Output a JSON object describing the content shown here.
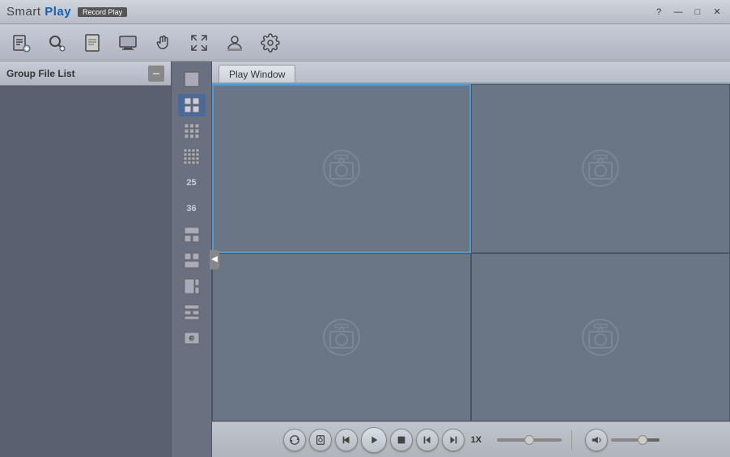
{
  "app": {
    "title_smart": "Smart",
    "title_play": "Play",
    "subtitle": "Record Play"
  },
  "titlebar": {
    "help": "?",
    "minimize": "—",
    "restore": "□",
    "close": "✕"
  },
  "toolbar": {
    "icons": [
      {
        "name": "add-file-icon",
        "label": "Add File"
      },
      {
        "name": "search-icon",
        "label": "Search"
      },
      {
        "name": "document-icon",
        "label": "Document"
      },
      {
        "name": "screen-icon",
        "label": "Screen"
      },
      {
        "name": "hand-icon",
        "label": "Pan"
      },
      {
        "name": "expand-icon",
        "label": "Expand"
      },
      {
        "name": "user-icon",
        "label": "User"
      },
      {
        "name": "settings-icon",
        "label": "Settings"
      }
    ]
  },
  "sidebar": {
    "title": "Group File List"
  },
  "play_tab": {
    "label": "Play Window"
  },
  "layout_buttons": [
    {
      "id": "layout-1x1",
      "label": "1 View"
    },
    {
      "id": "layout-2x2",
      "label": "4 View",
      "active": true
    },
    {
      "id": "layout-3x3",
      "label": "9 View"
    },
    {
      "id": "layout-4x4",
      "label": "16 View"
    },
    {
      "id": "layout-25",
      "label": "25 View"
    },
    {
      "id": "layout-36",
      "label": "36 View"
    },
    {
      "id": "layout-custom1",
      "label": "Custom 1"
    },
    {
      "id": "layout-custom2",
      "label": "Custom 2"
    },
    {
      "id": "layout-custom3",
      "label": "Custom 3"
    },
    {
      "id": "layout-custom4",
      "label": "Custom 4"
    },
    {
      "id": "layout-map",
      "label": "Map View"
    }
  ],
  "camera_cells": [
    {
      "id": 1,
      "selected": true
    },
    {
      "id": 2,
      "selected": false
    },
    {
      "id": 3,
      "selected": false
    },
    {
      "id": 4,
      "selected": false
    }
  ],
  "controls": {
    "sync_label": "↺",
    "clip_label": "⊕",
    "rewind_label": "↩",
    "play_label": "▶",
    "stop_label": "■",
    "prev_frame": "◀",
    "next_frame": "▶|",
    "speed": "1X",
    "volume_icon": "🔊"
  }
}
